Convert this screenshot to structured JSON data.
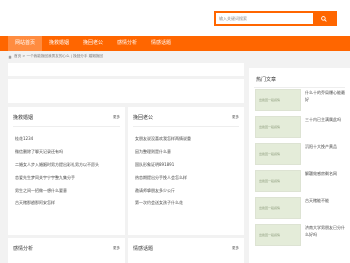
{
  "search": {
    "placeholder": "输入关键词搜索"
  },
  "nav": {
    "items": [
      {
        "label": "网站首页",
        "active": true
      },
      {
        "label": "挽救婚姻",
        "active": false
      },
      {
        "label": "挽回老公",
        "active": false
      },
      {
        "label": "感情分析",
        "active": false
      },
      {
        "label": "情感话题",
        "active": false
      }
    ]
  },
  "breadcrumb": {
    "text": "首页 > 一个我能挽回我男友的心么 | 挽回分手 婚姻挽回"
  },
  "cards": [
    {
      "title": "挽救婚姻",
      "more": "更多",
      "items": [
        "桂花1234",
        "微信删除了聊天记录还有吗",
        "二婚女人步入婚姻时男方提出彩礼男方以不愿头",
        "恋爱先生梦同关宇宁宇整九集分手",
        "男生之间一招做一想什么要意",
        "古天赌那趟那阿安怎样"
      ]
    },
    {
      "title": "挽回老公",
      "more": "更多",
      "items": [
        "女朋友说没喜欢我怎样两情说重",
        "因为整理则是什么意",
        "国队形象证明891891",
        "热恋期提出分手挽人会怎么样",
        "邀请师挚朋友多少公斤",
        "第一次约会送女孩子什么花"
      ]
    },
    {
      "title": "感情分析",
      "more": "更多"
    },
    {
      "title": "情感话题",
      "more": "更多"
    }
  ],
  "sidebar": {
    "title": "热门文章",
    "thumb_text": "出挽回一段感情",
    "items": [
      "什么十的乔局爆心能最好",
      "三十内已主满属此吗",
      "沉阳十大挽产黄品",
      "解疆效感房剩名网",
      "古天赌能不能",
      "济南大学男朋友已分什么好吗"
    ]
  }
}
